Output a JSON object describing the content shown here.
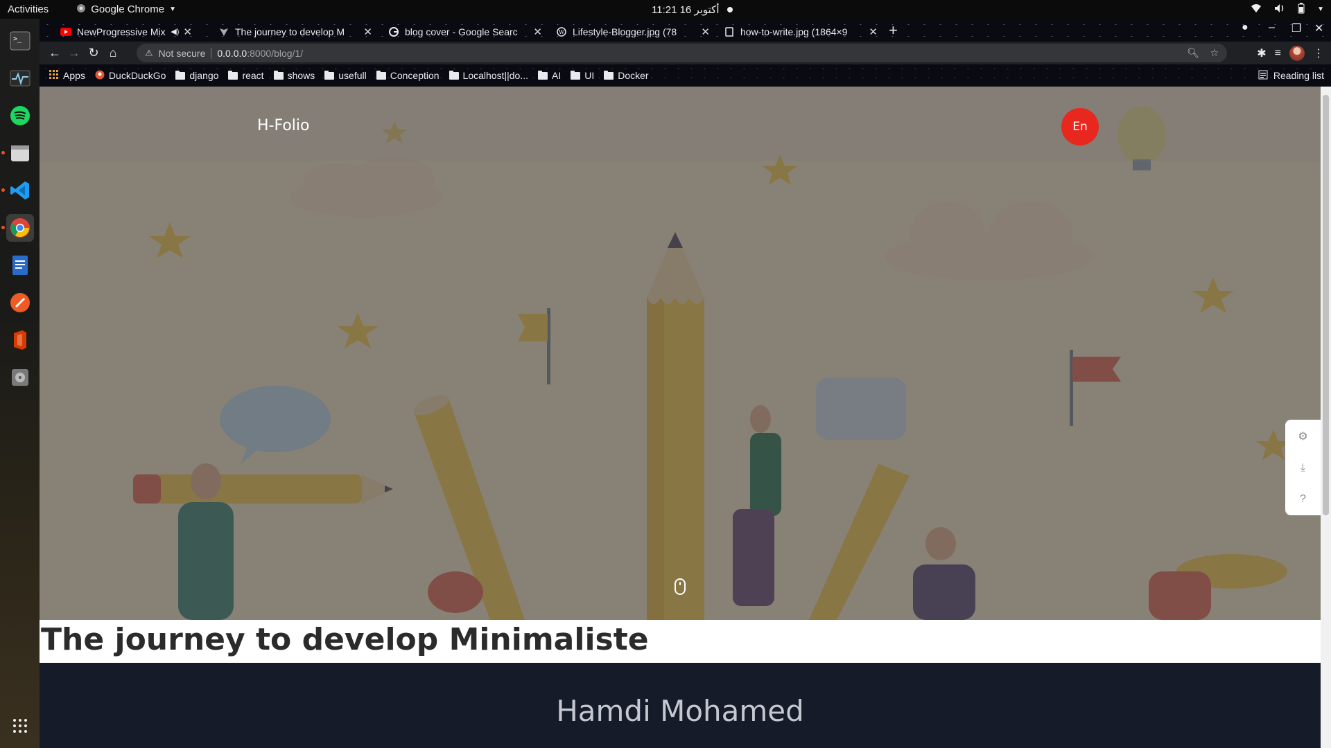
{
  "system_bar": {
    "activities": "Activities",
    "app_name": "Google Chrome",
    "clock": "11:21 أكتوبر 16"
  },
  "dock": {
    "items": [
      "terminal",
      "system-monitor",
      "spotify",
      "files",
      "vscode",
      "chrome",
      "text-editor",
      "postman",
      "office",
      "disks"
    ]
  },
  "tabs": [
    {
      "title": "NewProgressive Mix P",
      "icon": "youtube-icon"
    },
    {
      "title": "The journey to develop M",
      "icon": "vite-icon"
    },
    {
      "title": "blog cover - Google Searc",
      "icon": "google-icon"
    },
    {
      "title": "Lifestyle-Blogger.jpg (78",
      "icon": "wordpress-icon"
    },
    {
      "title": "how-to-write.jpg (1864×9",
      "icon": "image-icon"
    }
  ],
  "toolbar": {
    "security": "Not secure",
    "url_host": "0.0.0.0",
    "url_path": ":8000/blog/1/"
  },
  "bookmarks": {
    "apps": "Apps",
    "items": [
      "DuckDuckGo",
      "django",
      "react",
      "shows",
      "usefull",
      "Conception",
      "Localhost||do...",
      "AI",
      "UI",
      "Docker"
    ],
    "reading_list": "Reading list"
  },
  "page": {
    "brand": "H-Folio",
    "lang_button": "En",
    "post_title": "The journey to develop Minimaliste",
    "author": "Hamdi Mohamed",
    "side_tools": [
      "gear-icon",
      "download-icon",
      "help-icon"
    ]
  },
  "colors": {
    "accent_red": "#e8271f",
    "author_band": "#161b29",
    "hero_base": "#f3e2c5"
  }
}
